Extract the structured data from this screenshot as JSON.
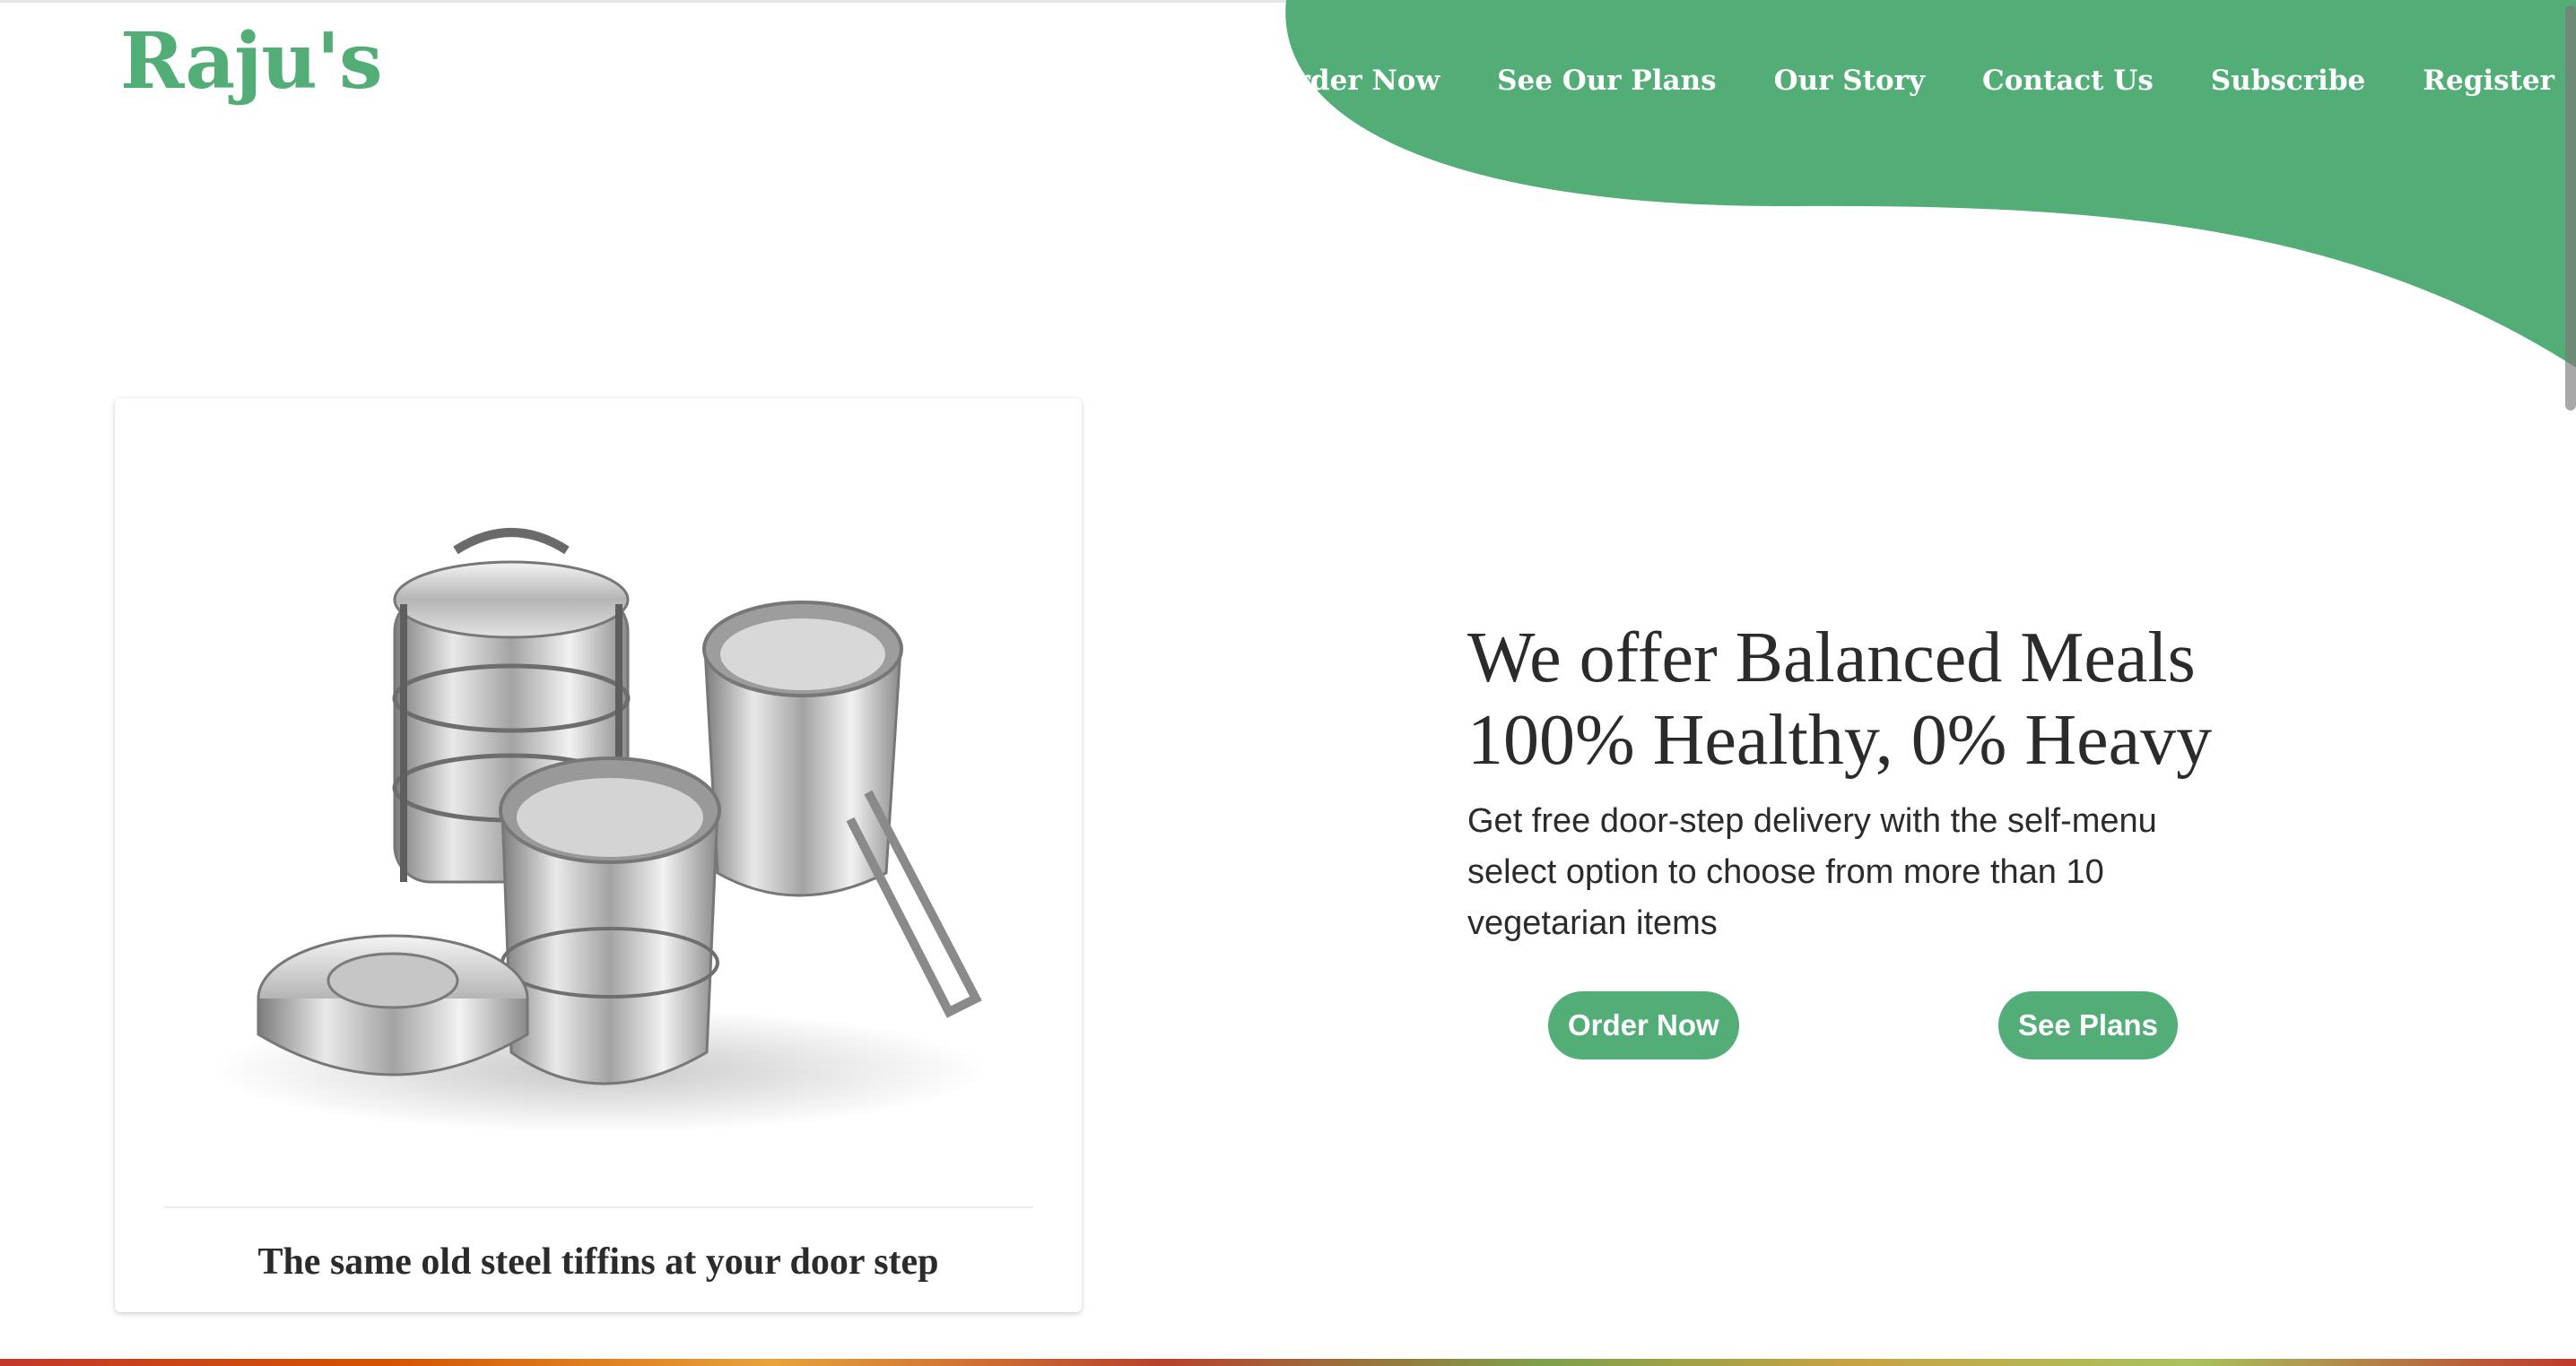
{
  "brand": {
    "logo_text": "Raju's",
    "accent_color": "#52ad77"
  },
  "nav": {
    "items": [
      {
        "label": "Order Now"
      },
      {
        "label": "See Our Plans"
      },
      {
        "label": "Our Story"
      },
      {
        "label": "Contact Us"
      },
      {
        "label": "Subscribe"
      },
      {
        "label": "Register"
      }
    ]
  },
  "card": {
    "image_icon": "steel-tiffin-image",
    "caption": "The same old steel tiffins at your door step"
  },
  "hero": {
    "title_line1": "We offer Balanced Meals",
    "title_line2": "100% Healthy, 0% Heavy",
    "description": "Get free door-step delivery with the self-menu select option to choose from more than 10 vegetarian items",
    "buttons": {
      "order_label": "Order Now",
      "plans_label": "See Plans"
    }
  }
}
